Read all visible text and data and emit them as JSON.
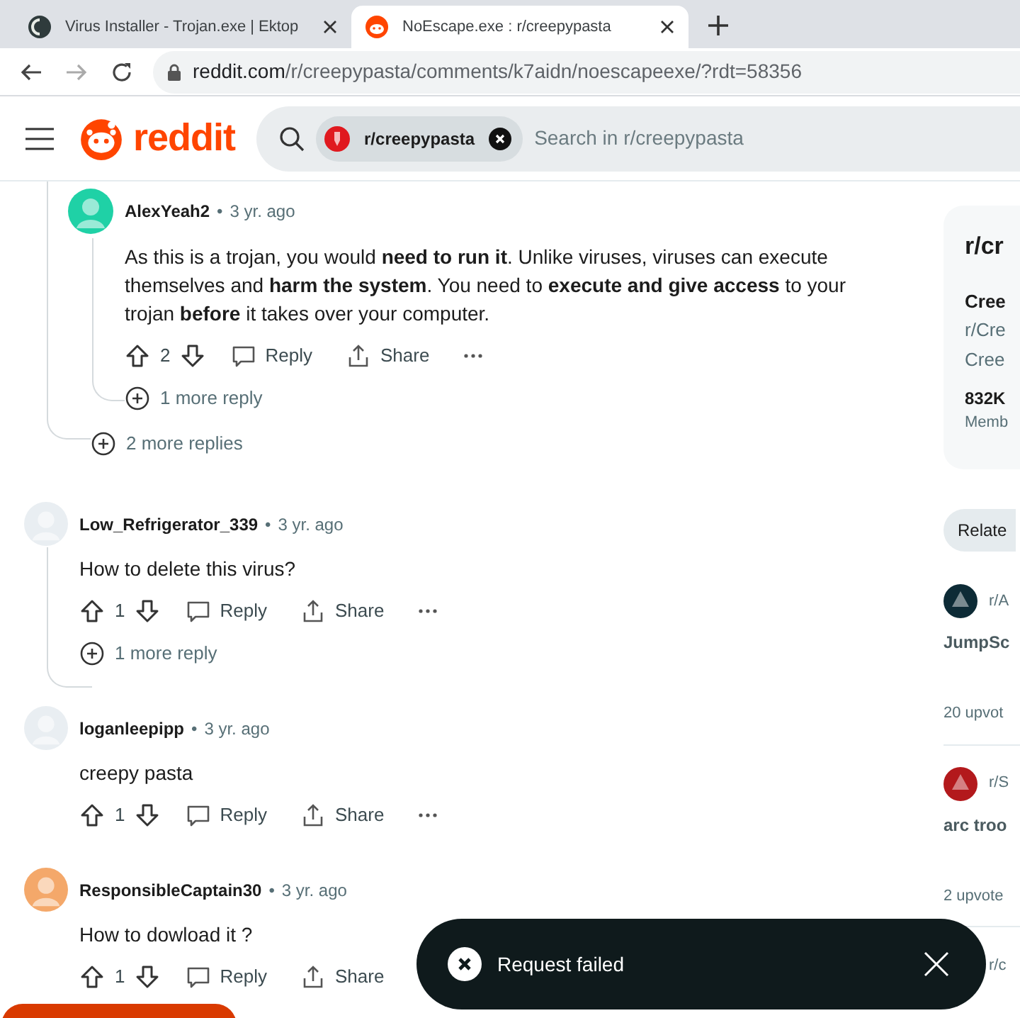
{
  "tabs": [
    {
      "title": "Virus Installer - Trojan.exe | Ektop",
      "selected": false
    },
    {
      "title": "NoEscape.exe : r/creepypasta",
      "selected": true
    }
  ],
  "address": {
    "domain": "reddit.com",
    "path": "/r/creepypasta/comments/k7aidn/noescapeexe/?rdt=58356"
  },
  "header": {
    "logo": "reddit",
    "community_chip": "r/creepypasta",
    "search_placeholder": "Search in r/creepypasta"
  },
  "comments": [
    {
      "replies": [
        {
          "author": "AlexYeah2",
          "separator": "•",
          "time": "3 yr. ago",
          "color": "#1fd1a6",
          "body": "As this is a trojan, you would **need to run it**. Unlike viruses, viruses can execute themselves and **harm the system**. You need to **execute and give access** to your trojan **before** it takes over your computer.",
          "votes": "2",
          "actions": [
            "Reply",
            "Share"
          ],
          "more_replies": "1 more reply"
        }
      ],
      "more_replies": "2 more replies"
    },
    {
      "author": "Low_Refrigerator_339",
      "separator": "•",
      "time": "3 yr. ago",
      "color": "#e9eef2",
      "body": "How to delete this virus?",
      "votes": "1",
      "actions": [
        "Reply",
        "Share"
      ],
      "more_replies": "1 more reply"
    },
    {
      "author": "loganleepipp",
      "separator": "•",
      "time": "3 yr. ago",
      "color": "#e9eef2",
      "body": "creepy pasta",
      "votes": "1",
      "actions": [
        "Reply",
        "Share"
      ]
    },
    {
      "author": "ResponsibleCaptain30",
      "separator": "•",
      "time": "3 yr. ago",
      "color": "#f4a86a",
      "body": "How to dowload it ?",
      "votes": "1",
      "actions": [
        "Reply",
        "Share"
      ]
    }
  ],
  "sidebar": {
    "title": "r/cr",
    "name": "Cree",
    "description_lines": [
      "r/Cre",
      "Cree"
    ],
    "members": "832K",
    "members_label": "Memb",
    "related_button": "Relate",
    "posts": [
      {
        "community": "r/A",
        "title": "JumpSc",
        "upvotes": "20 upvot",
        "color": "#0d2b36"
      },
      {
        "community": "r/S",
        "title": "arc troo",
        "upvotes": "2 upvote",
        "color": "#b3191c"
      },
      {
        "community": "r/c"
      }
    ]
  },
  "toast": {
    "message": "Request failed"
  }
}
